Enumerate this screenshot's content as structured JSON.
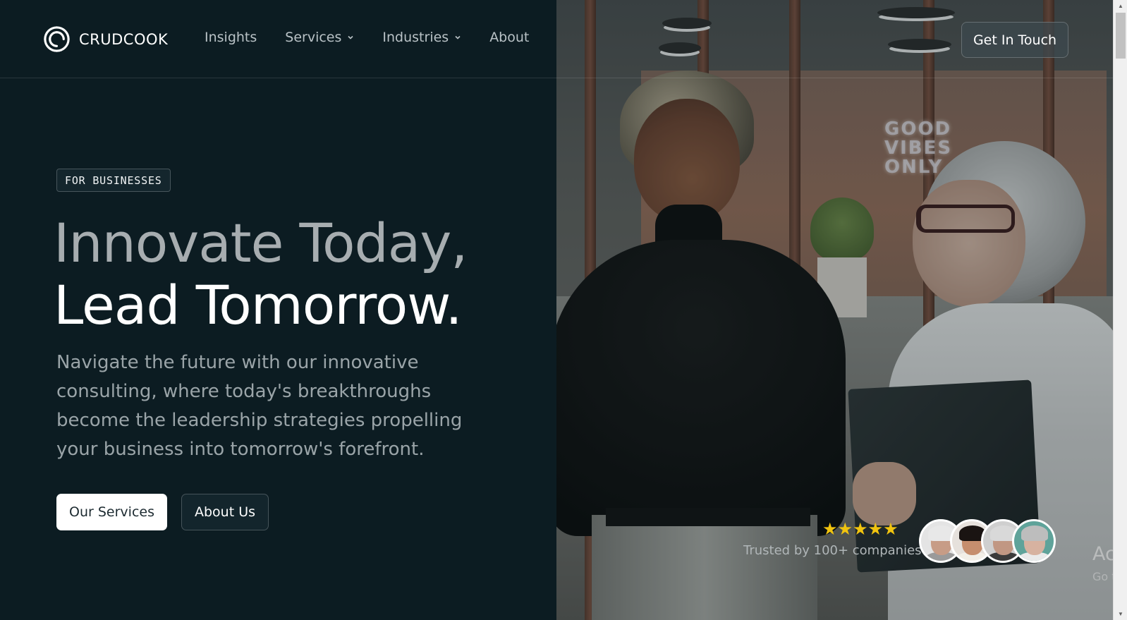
{
  "brand": {
    "name": "CRUDCOOK",
    "logo_icon": "swirl-logo-icon"
  },
  "nav": {
    "items": [
      {
        "label": "Insights",
        "has_dropdown": false
      },
      {
        "label": "Services",
        "has_dropdown": true
      },
      {
        "label": "Industries",
        "has_dropdown": true
      },
      {
        "label": "About",
        "has_dropdown": false
      }
    ],
    "cta_label": "Get In Touch"
  },
  "hero": {
    "badge": "FOR BUSINESSES",
    "headline_line1": "Innovate Today,",
    "headline_line2": "Lead Tomorrow.",
    "subtext": "Navigate the future with our innovative consulting, where today's breakthroughs become the leadership strategies propelling your business into tomorrow's forefront.",
    "primary_button": "Our Services",
    "secondary_button": "About Us",
    "image_alt_icon": "office-meeting-photo",
    "neon_sign": [
      "GOOD",
      "VIBES",
      "ONLY"
    ]
  },
  "trust": {
    "stars": "★★★★★",
    "rating": 5,
    "text": "Trusted by 100+ companies",
    "avatars": [
      "avatar-1",
      "avatar-2",
      "avatar-3",
      "avatar-4"
    ]
  },
  "watermark": {
    "line1": "Activate Windows",
    "line2": "Go to Settings to activate Windows."
  },
  "colors": {
    "background": "#0c1c22",
    "accent_star": "#f1c40f",
    "text_primary": "#ffffff",
    "text_muted": "#9aa4a8"
  }
}
